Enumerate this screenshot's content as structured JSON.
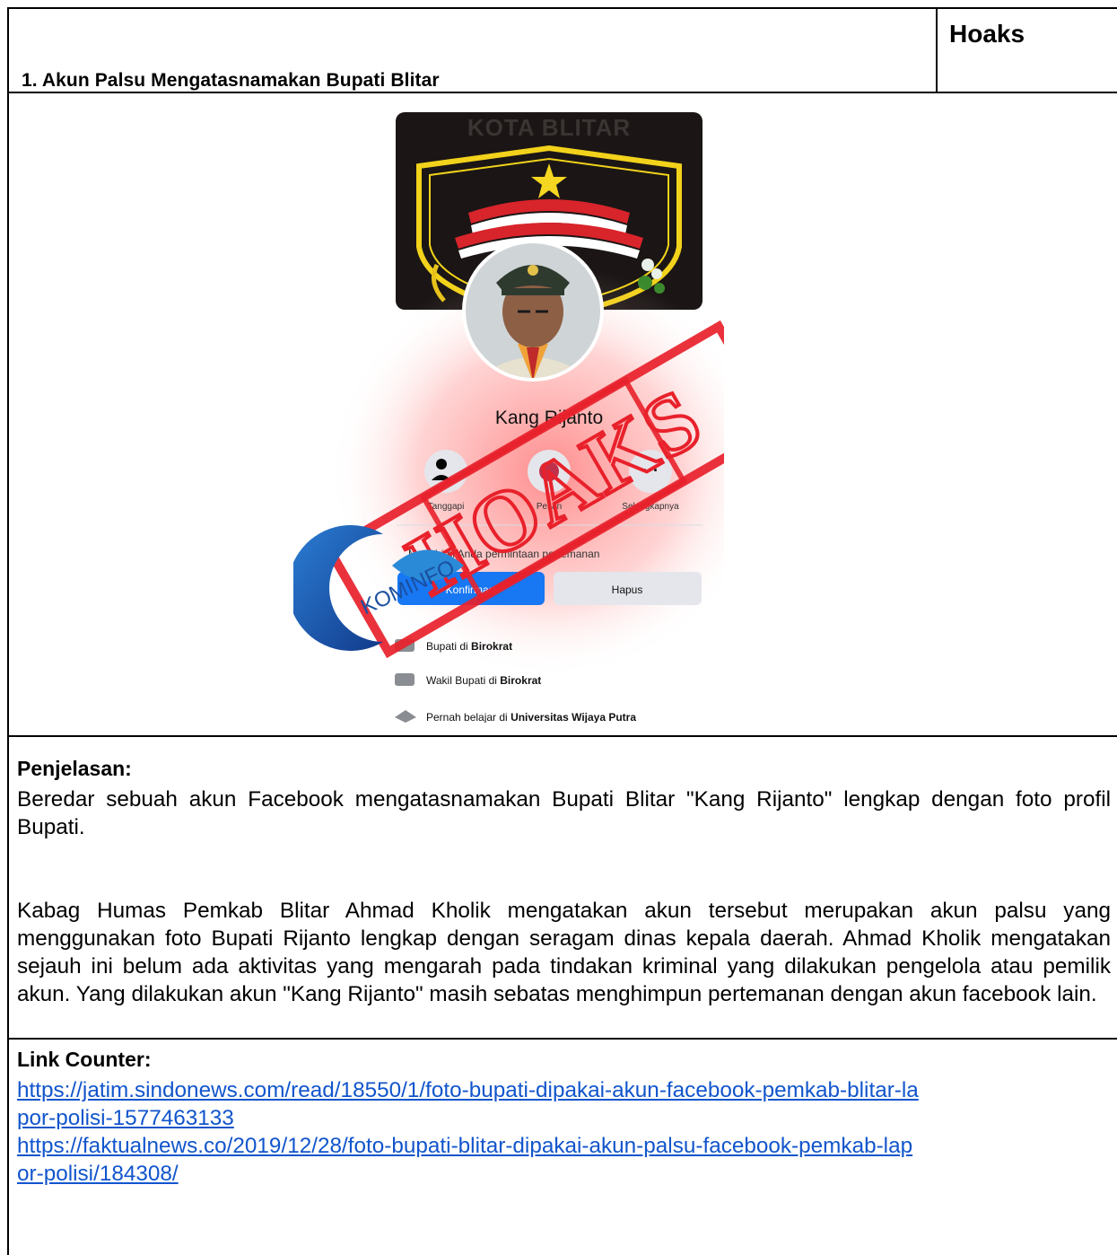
{
  "header": {
    "title": "1. Akun Palsu Mengatasnamakan Bupati Blitar",
    "label": "Hoaks"
  },
  "image": {
    "cover_text": "KOTA BLITAR",
    "stamp_text": "HOAKS",
    "watermark_text": "KOMINFO",
    "profile_name": "Kang Rijanto",
    "actions": [
      {
        "label": "Tanggapi",
        "icon": "person-check-icon"
      },
      {
        "label": "Pesan",
        "icon": "messenger-icon"
      },
      {
        "label": "Selengkapnya",
        "icon": "more-icon"
      }
    ],
    "request_text": "Mengirimi Anda permintaan pertemanan",
    "confirm_label": "Konfirmasi",
    "delete_label": "Hapus",
    "info": [
      {
        "prefix": "Bupati di ",
        "bold": "Birokrat"
      },
      {
        "prefix": "Wakil Bupati di ",
        "bold": "Birokrat"
      },
      {
        "prefix": "Pernah belajar di ",
        "bold": "Universitas Wijaya Putra"
      }
    ],
    "colors": {
      "accent_red": "#e8212b",
      "facebook_blue": "#1877f2",
      "kominfo_blue": "#1a4fa0"
    }
  },
  "explanation": {
    "heading": "Penjelasan:",
    "para1": "Beredar sebuah akun Facebook mengatasnamakan Bupati Blitar \"Kang Rijanto\" lengkap dengan foto profil Bupati.",
    "para2": "Kabag Humas Pemkab Blitar Ahmad Kholik mengatakan akun tersebut merupakan akun palsu yang menggunakan foto Bupati Rijanto lengkap dengan seragam dinas kepala daerah. Ahmad Kholik mengatakan sejauh ini belum ada aktivitas yang mengarah pada tindakan kriminal yang dilakukan pengelola atau pemilik akun. Yang dilakukan akun \"Kang Rijanto\" masih sebatas menghimpun pertemanan dengan akun facebook lain."
  },
  "counter": {
    "heading": "Link Counter:",
    "links": [
      {
        "line1": "https://jatim.sindonews.com/read/18550/1/foto-bupati-dipakai-akun-facebook-pemkab-blitar-la",
        "line2": "por-polisi-1577463133"
      },
      {
        "line1": "https://faktualnews.co/2019/12/28/foto-bupati-blitar-dipakai-akun-palsu-facebook-pemkab-lap",
        "line2": "or-polisi/184308/"
      }
    ]
  }
}
